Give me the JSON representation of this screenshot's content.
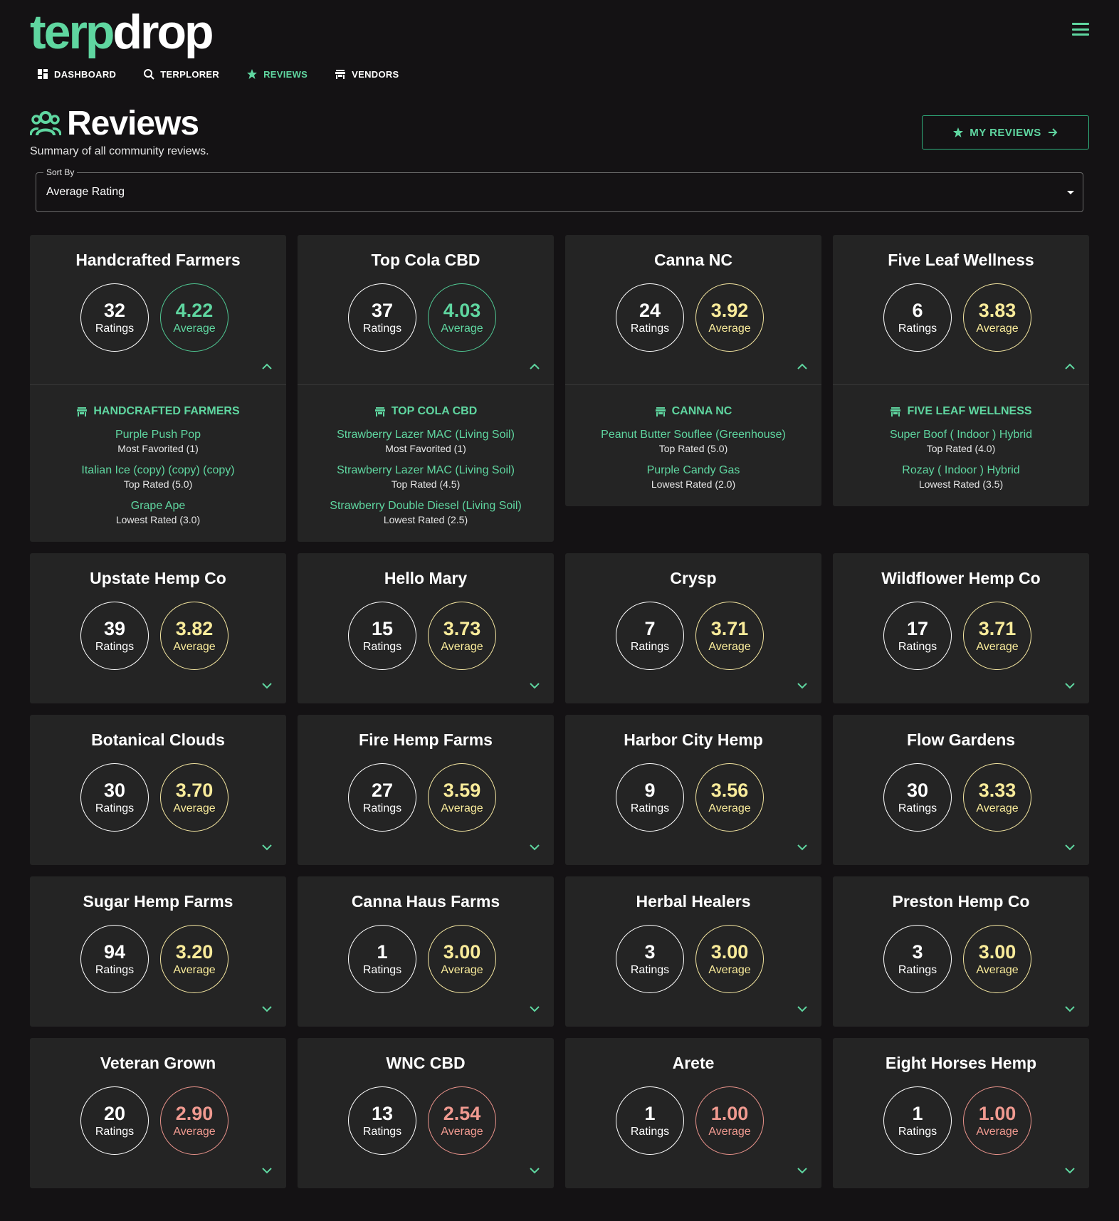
{
  "logo": {
    "part1": "terp",
    "part2": "drop"
  },
  "nav": [
    {
      "label": "DASHBOARD",
      "icon": "dashboard-icon"
    },
    {
      "label": "TERPLORER",
      "icon": "search-icon"
    },
    {
      "label": "REVIEWS",
      "icon": "star-icon",
      "active": true
    },
    {
      "label": "VENDORS",
      "icon": "store-icon"
    }
  ],
  "page": {
    "title": "Reviews",
    "subtitle": "Summary of all community reviews.",
    "my_reviews_label": "MY REVIEWS"
  },
  "sort": {
    "label": "Sort By",
    "value": "Average Rating"
  },
  "colors": {
    "accent": "#5fd6a0",
    "yellow": "#f9eb9a",
    "red": "#f09a90",
    "card": "#242424",
    "bg": "#141214"
  },
  "vendors": [
    {
      "name": "Handcrafted Farmers",
      "ratings": "32",
      "ratings_label": "Ratings",
      "average": "4.22",
      "average_label": "Average",
      "tone": "green",
      "expanded": true,
      "detail": {
        "vendor": "HANDCRAFTED FARMERS",
        "items": [
          {
            "strain": "Purple Push Pop",
            "note": "Most Favorited (1)"
          },
          {
            "strain": "Italian Ice (copy) (copy) (copy)",
            "note": "Top Rated (5.0)"
          },
          {
            "strain": "Grape Ape",
            "note": "Lowest Rated (3.0)"
          }
        ]
      }
    },
    {
      "name": "Top Cola CBD",
      "ratings": "37",
      "ratings_label": "Ratings",
      "average": "4.03",
      "average_label": "Average",
      "tone": "green",
      "expanded": true,
      "detail": {
        "vendor": "TOP COLA CBD",
        "items": [
          {
            "strain": "Strawberry Lazer MAC (Living Soil)",
            "note": "Most Favorited (1)"
          },
          {
            "strain": "Strawberry Lazer MAC (Living Soil)",
            "note": "Top Rated (4.5)"
          },
          {
            "strain": "Strawberry Double Diesel (Living Soil)",
            "note": "Lowest Rated (2.5)"
          }
        ]
      }
    },
    {
      "name": "Canna NC",
      "ratings": "24",
      "ratings_label": "Ratings",
      "average": "3.92",
      "average_label": "Average",
      "tone": "yellow",
      "expanded": true,
      "detail": {
        "vendor": "CANNA NC",
        "items": [
          {
            "strain": "Peanut Butter Souflee (Greenhouse)",
            "note": "Top Rated (5.0)"
          },
          {
            "strain": "Purple Candy Gas",
            "note": "Lowest Rated (2.0)"
          }
        ]
      }
    },
    {
      "name": "Five Leaf Wellness",
      "ratings": "6",
      "ratings_label": "Ratings",
      "average": "3.83",
      "average_label": "Average",
      "tone": "yellow",
      "expanded": true,
      "detail": {
        "vendor": "FIVE LEAF WELLNESS",
        "items": [
          {
            "strain": "Super Boof ( Indoor ) Hybrid",
            "note": "Top Rated (4.0)"
          },
          {
            "strain": "Rozay ( Indoor ) Hybrid",
            "note": "Lowest Rated (3.5)"
          }
        ]
      }
    },
    {
      "name": "Upstate Hemp Co",
      "ratings": "39",
      "ratings_label": "Ratings",
      "average": "3.82",
      "average_label": "Average",
      "tone": "yellow",
      "expanded": false
    },
    {
      "name": "Hello Mary",
      "ratings": "15",
      "ratings_label": "Ratings",
      "average": "3.73",
      "average_label": "Average",
      "tone": "yellow",
      "expanded": false
    },
    {
      "name": "Crysp",
      "ratings": "7",
      "ratings_label": "Ratings",
      "average": "3.71",
      "average_label": "Average",
      "tone": "yellow",
      "expanded": false
    },
    {
      "name": "Wildflower Hemp Co",
      "ratings": "17",
      "ratings_label": "Ratings",
      "average": "3.71",
      "average_label": "Average",
      "tone": "yellow",
      "expanded": false
    },
    {
      "name": "Botanical Clouds",
      "ratings": "30",
      "ratings_label": "Ratings",
      "average": "3.70",
      "average_label": "Average",
      "tone": "yellow",
      "expanded": false
    },
    {
      "name": "Fire Hemp Farms",
      "ratings": "27",
      "ratings_label": "Ratings",
      "average": "3.59",
      "average_label": "Average",
      "tone": "yellow",
      "expanded": false
    },
    {
      "name": "Harbor City Hemp",
      "ratings": "9",
      "ratings_label": "Ratings",
      "average": "3.56",
      "average_label": "Average",
      "tone": "yellow",
      "expanded": false
    },
    {
      "name": "Flow Gardens",
      "ratings": "30",
      "ratings_label": "Ratings",
      "average": "3.33",
      "average_label": "Average",
      "tone": "yellow",
      "expanded": false
    },
    {
      "name": "Sugar Hemp Farms",
      "ratings": "94",
      "ratings_label": "Ratings",
      "average": "3.20",
      "average_label": "Average",
      "tone": "yellow",
      "expanded": false
    },
    {
      "name": "Canna Haus Farms",
      "ratings": "1",
      "ratings_label": "Ratings",
      "average": "3.00",
      "average_label": "Average",
      "tone": "yellow",
      "expanded": false
    },
    {
      "name": "Herbal Healers",
      "ratings": "3",
      "ratings_label": "Ratings",
      "average": "3.00",
      "average_label": "Average",
      "tone": "yellow",
      "expanded": false
    },
    {
      "name": "Preston Hemp Co",
      "ratings": "3",
      "ratings_label": "Ratings",
      "average": "3.00",
      "average_label": "Average",
      "tone": "yellow",
      "expanded": false
    },
    {
      "name": "Veteran Grown",
      "ratings": "20",
      "ratings_label": "Ratings",
      "average": "2.90",
      "average_label": "Average",
      "tone": "red",
      "expanded": false
    },
    {
      "name": "WNC CBD",
      "ratings": "13",
      "ratings_label": "Ratings",
      "average": "2.54",
      "average_label": "Average",
      "tone": "red",
      "expanded": false
    },
    {
      "name": "Arete",
      "ratings": "1",
      "ratings_label": "Ratings",
      "average": "1.00",
      "average_label": "Average",
      "tone": "red",
      "expanded": false
    },
    {
      "name": "Eight Horses Hemp",
      "ratings": "1",
      "ratings_label": "Ratings",
      "average": "1.00",
      "average_label": "Average",
      "tone": "red",
      "expanded": false
    }
  ]
}
